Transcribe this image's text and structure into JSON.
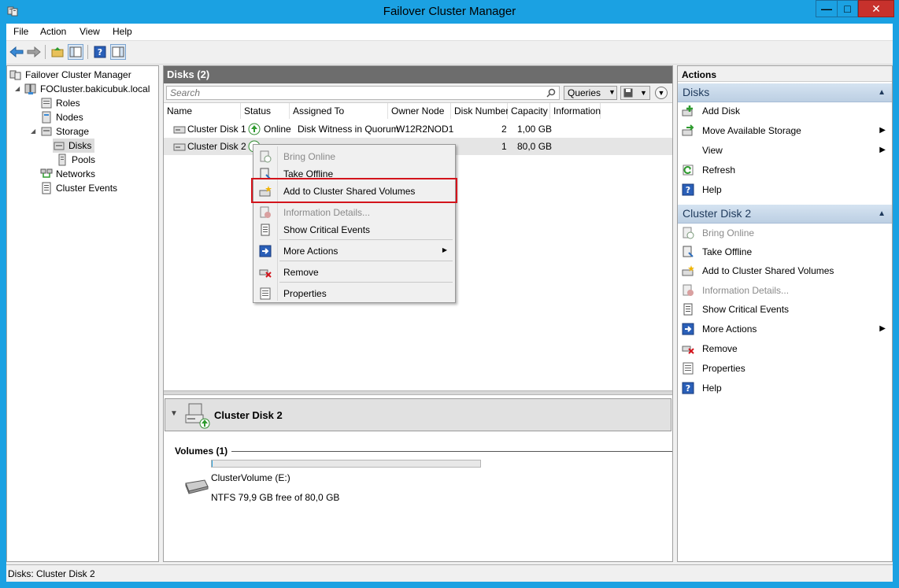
{
  "window": {
    "title": "Failover Cluster Manager",
    "minimize": "—",
    "maximize": "□",
    "close": "✕"
  },
  "menu": [
    "File",
    "Action",
    "View",
    "Help"
  ],
  "tree": {
    "root": "Failover Cluster Manager",
    "cluster": "FOCluster.bakicubuk.local",
    "items": [
      "Roles",
      "Nodes",
      "Storage",
      "Disks",
      "Pools",
      "Networks",
      "Cluster Events"
    ]
  },
  "center": {
    "header": "Disks (2)",
    "search_placeholder": "Search",
    "queries_label": "Queries",
    "columns": [
      "Name",
      "Status",
      "Assigned To",
      "Owner Node",
      "Disk Number",
      "Capacity",
      "Information"
    ],
    "rows": [
      {
        "name": "Cluster Disk 1",
        "status": "Online",
        "assigned_to": "Disk Witness in Quorum",
        "owner": "W12R2NOD1",
        "disk_number": "2",
        "capacity": "1,00 GB",
        "information": ""
      },
      {
        "name": "Cluster Disk 2",
        "status": "",
        "assigned_to": "",
        "owner": "",
        "disk_number": "1",
        "capacity": "80,0 GB",
        "information": ""
      }
    ]
  },
  "detail": {
    "title": "Cluster Disk 2",
    "volumes_label": "Volumes (1)",
    "volume_name": "ClusterVolume (E:)",
    "volume_info": "NTFS 79,9 GB free of 80,0 GB",
    "used_fraction": 0.00125
  },
  "context_menu": {
    "items": [
      "Bring Online",
      "Take Offline",
      "Add to Cluster Shared Volumes",
      "Information Details...",
      "Show Critical Events",
      "More Actions",
      "Remove",
      "Properties"
    ]
  },
  "actions": {
    "title": "Actions",
    "section1": "Disks",
    "section1_items": [
      "Add Disk",
      "Move Available Storage",
      "View",
      "Refresh",
      "Help"
    ],
    "section2": "Cluster Disk 2",
    "section2_items": [
      "Bring Online",
      "Take Offline",
      "Add to Cluster Shared Volumes",
      "Information Details...",
      "Show Critical Events",
      "More Actions",
      "Remove",
      "Properties",
      "Help"
    ]
  },
  "statusbar": {
    "text": "Disks:  Cluster Disk 2"
  },
  "colors": {
    "window_frame": "#1ba1e2",
    "highlight_red": "#d3141c",
    "section_header": "#1e395b"
  }
}
